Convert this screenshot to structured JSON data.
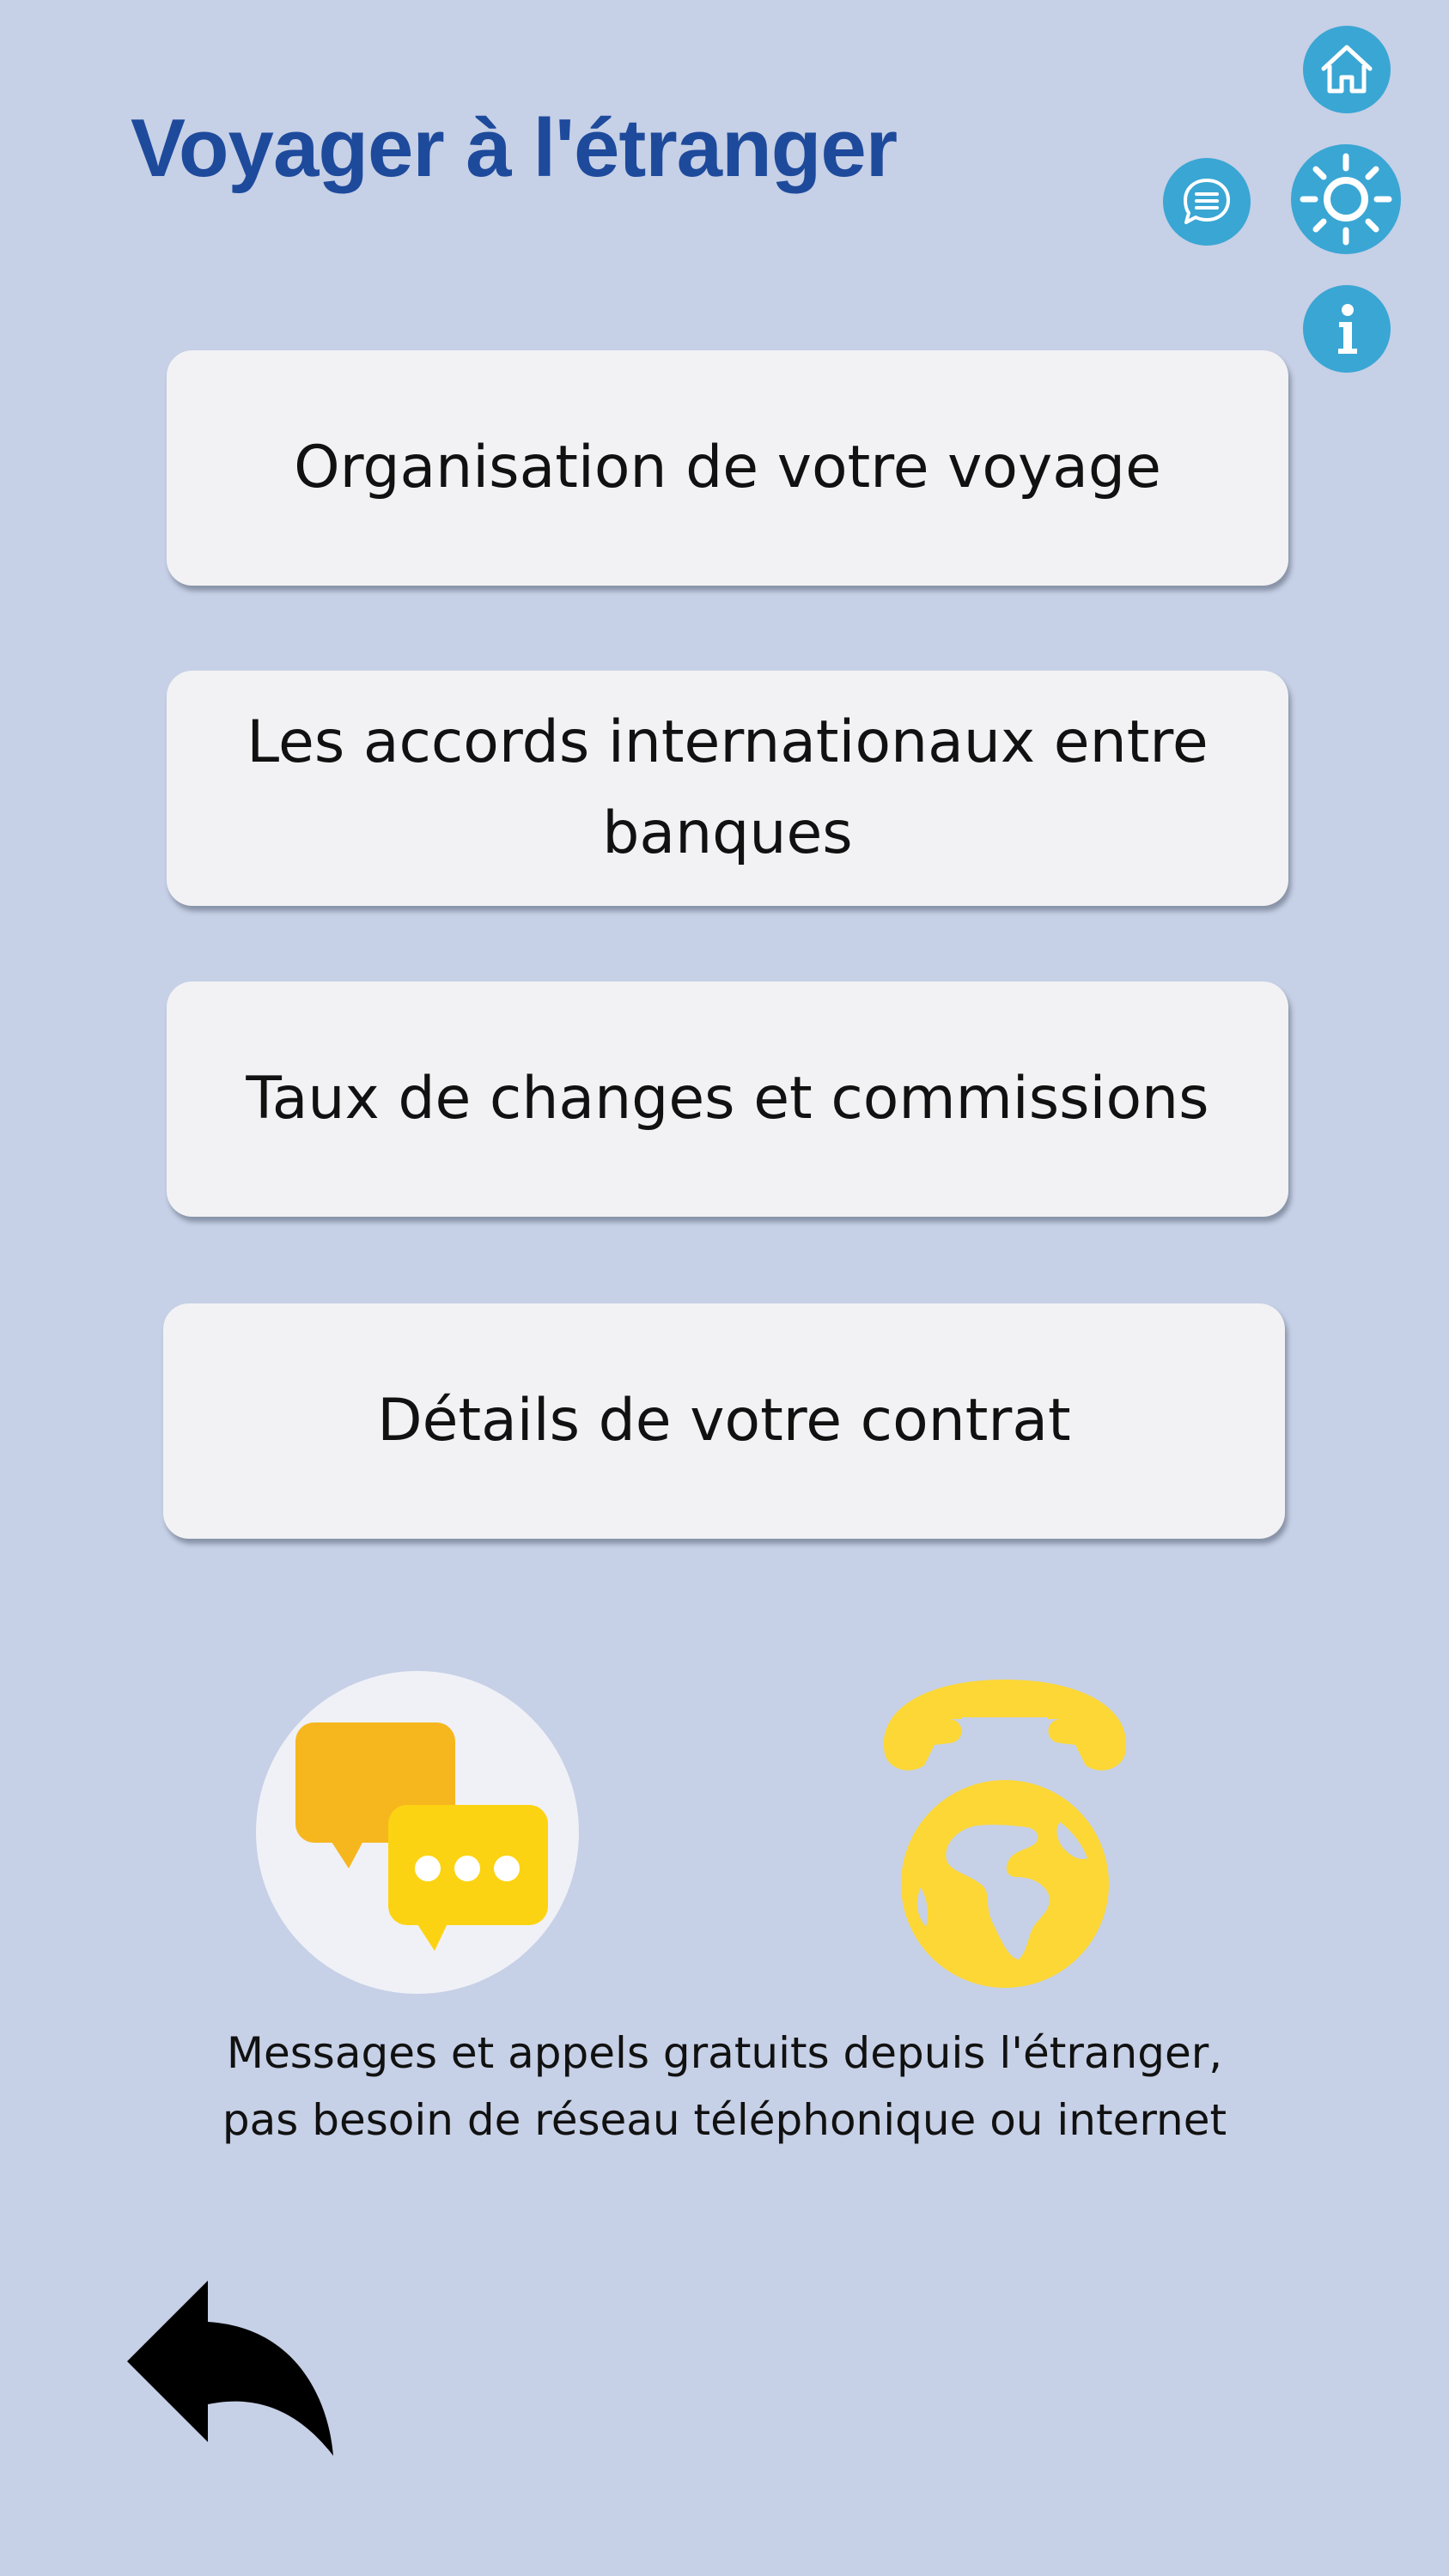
{
  "header": {
    "title": "Voyager à l'étranger"
  },
  "toolbar": {
    "home_icon": "home-icon",
    "chat_icon": "chat-icon",
    "brightness_icon": "brightness-icon",
    "info_icon": "info-icon",
    "accent_color": "#3aa6d4"
  },
  "menu": {
    "items": [
      {
        "label": "Organisation de votre voyage"
      },
      {
        "label_line1": "Les accords internationaux entre",
        "label_line2": "banques"
      },
      {
        "label": "Taux de changes et commissions"
      },
      {
        "label": "Détails de votre contrat"
      }
    ]
  },
  "features": {
    "messages_icon": "speech-bubbles-icon",
    "phone_icon": "phone-globe-icon",
    "caption_line1": "Messages et appels gratuits depuis l'étranger,",
    "caption_line2": "pas besoin de réseau téléphonique ou internet"
  },
  "navigation": {
    "back_icon": "back-arrow-icon"
  },
  "colors": {
    "background": "#c6d0e6",
    "title": "#1e4a9c",
    "card": "#f2f2f4",
    "yellow": "#fcd735",
    "orange": "#f6b61e"
  }
}
